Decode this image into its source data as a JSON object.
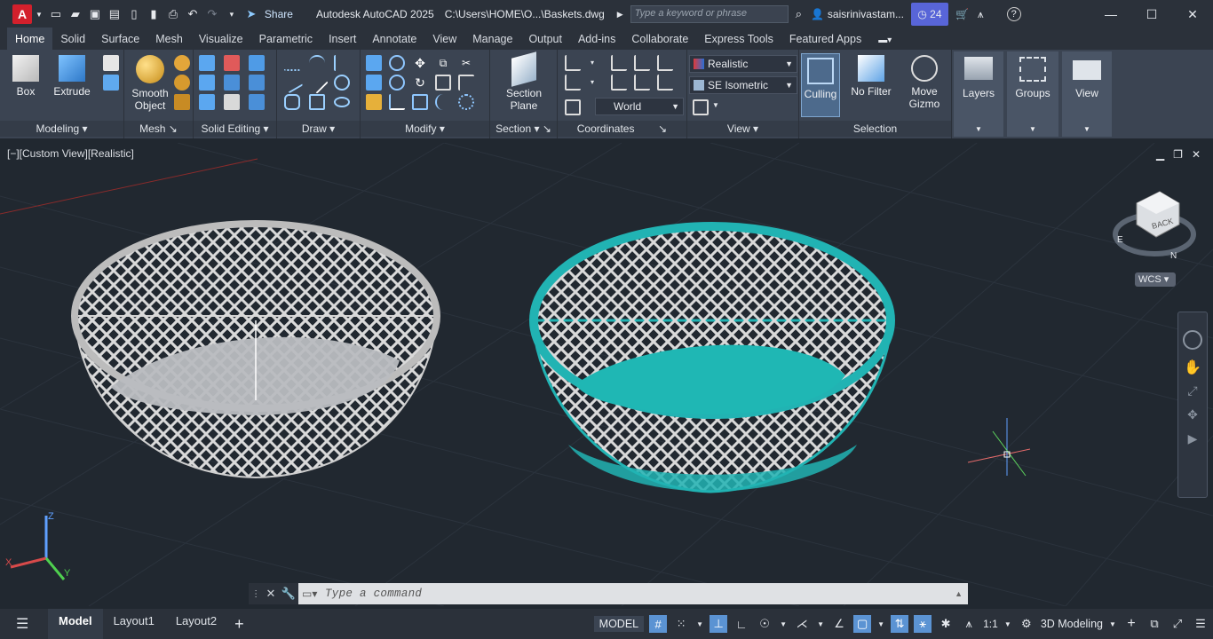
{
  "titlebar": {
    "app_letter": "A",
    "share_label": "Share",
    "app_title": "Autodesk AutoCAD 2025",
    "file_path": "C:\\Users\\HOME\\O...\\Baskets.dwg",
    "search_placeholder": "Type a keyword or phrase",
    "user": "saisrinivastam...",
    "notifications": "24"
  },
  "tabs": [
    "Home",
    "Solid",
    "Surface",
    "Mesh",
    "Visualize",
    "Parametric",
    "Insert",
    "Annotate",
    "View",
    "Manage",
    "Output",
    "Add-ins",
    "Collaborate",
    "Express Tools",
    "Featured Apps"
  ],
  "ribbon": {
    "box": "Box",
    "extrude": "Extrude",
    "smooth_object": "Smooth Object",
    "section_plane": "Section Plane",
    "culling": "Culling",
    "no_filter": "No Filter",
    "move_gizmo": "Move Gizmo",
    "layers": "Layers",
    "groups": "Groups",
    "view": "View",
    "visual_style": "Realistic",
    "view_preset": "SE Isometric",
    "ucs": "World",
    "panels": {
      "modeling": "Modeling",
      "mesh": "Mesh",
      "solid_editing": "Solid Editing",
      "draw": "Draw",
      "modify": "Modify",
      "section": "Section",
      "coordinates": "Coordinates",
      "view": "View",
      "selection": "Selection"
    }
  },
  "viewport": {
    "label": "[−][Custom View][Realistic]",
    "viewcube_face": "BACK",
    "wcs": "WCS",
    "compass_e": "E",
    "compass_n": "N",
    "axis_z": "Z",
    "axis_x": "X",
    "axis_y": "Y"
  },
  "command": {
    "placeholder": "Type  a  command"
  },
  "statusbar": {
    "model_tab": "Model",
    "layout1": "Layout1",
    "layout2": "Layout2",
    "model_badge": "MODEL",
    "scale": "1:1",
    "workspace": "3D Modeling"
  },
  "colors": {
    "accent": "#5b93d3",
    "basket_teal": "#21b3b3",
    "basket_grey": "#c8c8c8",
    "app_red": "#d3202c"
  }
}
